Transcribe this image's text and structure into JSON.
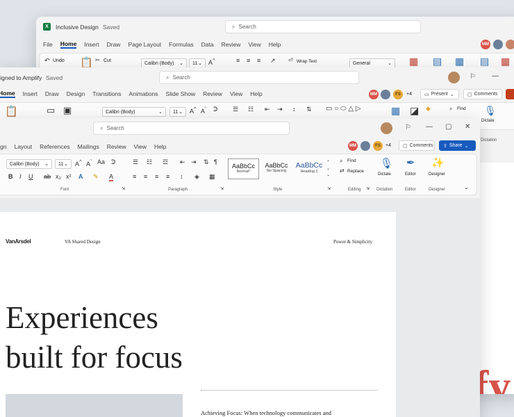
{
  "excel": {
    "title": "Inclusive Design",
    "saved": "Saved",
    "search": "Search",
    "menu": [
      "File",
      "Home",
      "Insert",
      "Draw",
      "Page Layout",
      "Formulas",
      "Data",
      "Review",
      "View",
      "Help"
    ],
    "undo": "Undo",
    "cut": "Cut",
    "font": "Calibri (Body)",
    "size": "11",
    "wrap": "Wrap Text",
    "format": "General",
    "avatar_initials": "MM"
  },
  "powerpoint": {
    "title": "signed to Amplify",
    "saved": "Saved",
    "search": "Search",
    "menu": [
      "Home",
      "Insert",
      "Draw",
      "Design",
      "Transitions",
      "Animations",
      "Slide Show",
      "Review",
      "View",
      "Help"
    ],
    "font": "Calibri (Body)",
    "size": "11",
    "present": "Present",
    "comments": "Comments",
    "find": "Find",
    "dictate": "Dictate",
    "dictation_group": "Dictation",
    "avatars": [
      "MM",
      "FS"
    ],
    "plus": "+4",
    "slide_text": "fy."
  },
  "word": {
    "search": "Search",
    "menu": [
      "sign",
      "Layout",
      "References",
      "Mailings",
      "Review",
      "View",
      "Help"
    ],
    "font": "Calibri (Body)",
    "size": "11",
    "styles": [
      {
        "preview": "AaBbCc",
        "name": "Normal*"
      },
      {
        "preview": "AaBbCc",
        "name": "No Spacing"
      },
      {
        "preview": "AaBbCc",
        "name": "Heading 1"
      }
    ],
    "find": "Find",
    "replace": "Replace",
    "dictate": "Dictate",
    "editor": "Editor",
    "designer": "Designer",
    "groups": {
      "font": "Font",
      "paragraph": "Paragraph",
      "style": "Style",
      "editing": "Editing",
      "dictation": "Dictation",
      "editor": "Editor",
      "designer": "Designer"
    },
    "comments": "Comments",
    "share": "Share",
    "avatars": [
      "MM",
      "FS"
    ],
    "plus": "+4",
    "doc": {
      "logo": "VanArsdel",
      "header_center": "VA Shared Design",
      "header_right": "Power & Simplicity",
      "headline_1": "Experiences",
      "headline_2": "built for focus",
      "sub_heading": "Achieving Focus: When technology communicates and"
    }
  },
  "colors": {
    "accent": "#185abd",
    "excel_green": "#107c41",
    "ppt_red": "#c43e1c",
    "slide_pink": "#d9534a"
  }
}
